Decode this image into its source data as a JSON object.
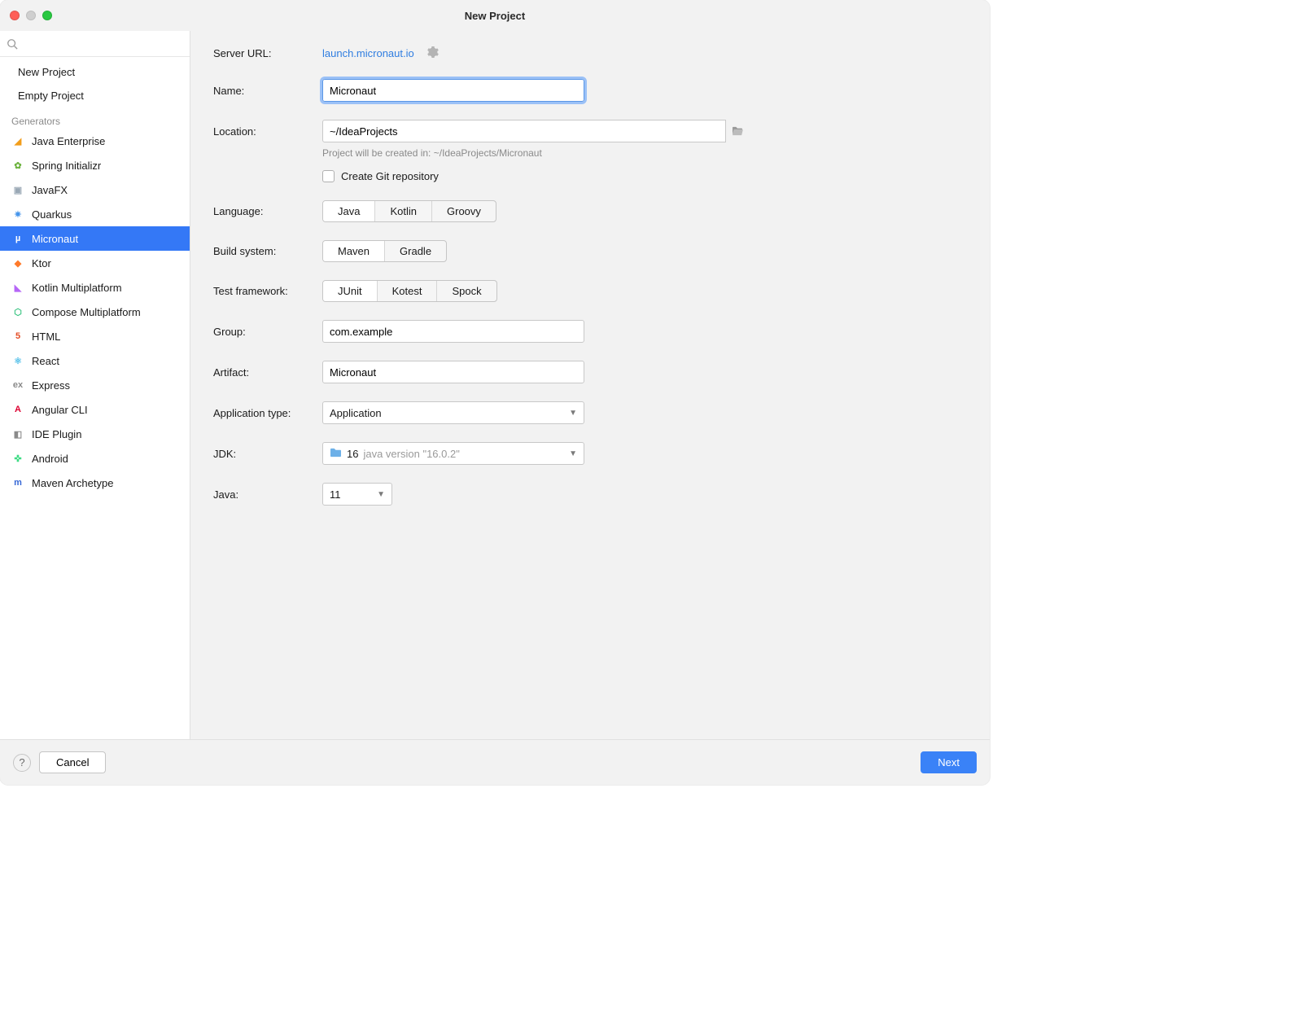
{
  "window": {
    "title": "New Project"
  },
  "sidebar": {
    "items": [
      "New Project",
      "Empty Project"
    ],
    "section": "Generators",
    "generators": [
      "Java Enterprise",
      "Spring Initializr",
      "JavaFX",
      "Quarkus",
      "Micronaut",
      "Ktor",
      "Kotlin Multiplatform",
      "Compose Multiplatform",
      "HTML",
      "React",
      "Express",
      "Angular CLI",
      "IDE Plugin",
      "Android",
      "Maven Archetype"
    ],
    "selected": "Micronaut"
  },
  "form": {
    "serverUrlLabel": "Server URL:",
    "serverUrl": "launch.micronaut.io",
    "nameLabel": "Name:",
    "name": "Micronaut",
    "locationLabel": "Location:",
    "location": "~/IdeaProjects",
    "locationHint": "Project will be created in: ~/IdeaProjects/Micronaut",
    "gitLabel": "Create Git repository",
    "languageLabel": "Language:",
    "languages": [
      "Java",
      "Kotlin",
      "Groovy"
    ],
    "languageSelected": "Java",
    "buildLabel": "Build system:",
    "builds": [
      "Maven",
      "Gradle"
    ],
    "buildSelected": "Maven",
    "testLabel": "Test framework:",
    "tests": [
      "JUnit",
      "Kotest",
      "Spock"
    ],
    "testSelected": "JUnit",
    "groupLabel": "Group:",
    "group": "com.example",
    "artifactLabel": "Artifact:",
    "artifact": "Micronaut",
    "appTypeLabel": "Application type:",
    "appType": "Application",
    "jdkLabel": "JDK:",
    "jdkValue": "16",
    "jdkVersion": "java version \"16.0.2\"",
    "javaLabel": "Java:",
    "javaValue": "11"
  },
  "footer": {
    "help": "?",
    "cancel": "Cancel",
    "next": "Next"
  },
  "icons": {
    "generators": {
      "Java Enterprise": {
        "glyph": "◢",
        "color": "#f29d1a"
      },
      "Spring Initializr": {
        "glyph": "✿",
        "color": "#6db33f"
      },
      "JavaFX": {
        "glyph": "▣",
        "color": "#9aa8b5"
      },
      "Quarkus": {
        "glyph": "✷",
        "color": "#4695eb"
      },
      "Micronaut": {
        "glyph": "µ",
        "color": "#ffffff"
      },
      "Ktor": {
        "glyph": "◆",
        "color": "#ff7a2a"
      },
      "Kotlin Multiplatform": {
        "glyph": "◣",
        "color": "#b666f7"
      },
      "Compose Multiplatform": {
        "glyph": "⬡",
        "color": "#3ac482"
      },
      "HTML": {
        "glyph": "5",
        "color": "#e44d26"
      },
      "React": {
        "glyph": "⚛",
        "color": "#5cc3ea"
      },
      "Express": {
        "glyph": "ex",
        "color": "#8a8a8a"
      },
      "Angular CLI": {
        "glyph": "A",
        "color": "#dd0031"
      },
      "IDE Plugin": {
        "glyph": "◧",
        "color": "#8a8a8a"
      },
      "Android": {
        "glyph": "✜",
        "color": "#3ddc84"
      },
      "Maven Archetype": {
        "glyph": "m",
        "color": "#3768d6"
      }
    }
  }
}
